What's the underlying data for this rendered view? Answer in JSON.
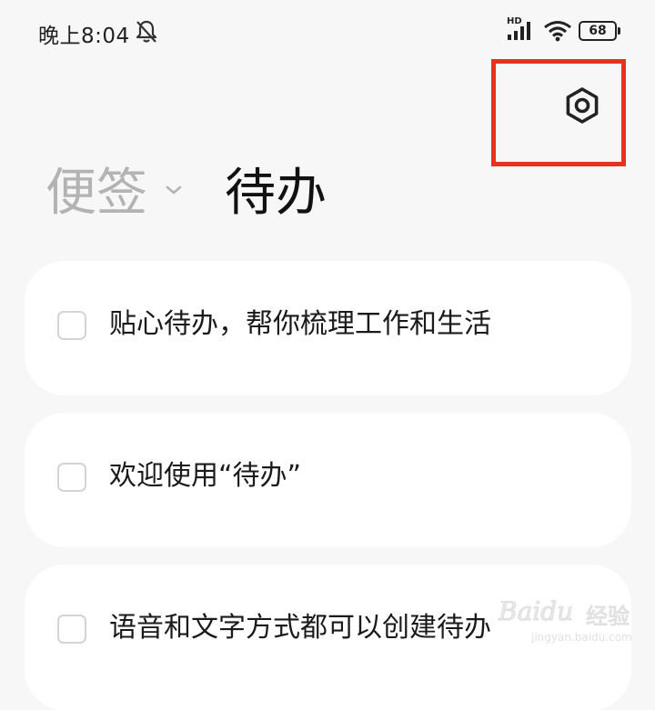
{
  "status_bar": {
    "time": "晚上8:04",
    "network_label": "HD",
    "battery_level": "68"
  },
  "header": {
    "notes_tab_label": "便签",
    "todo_tab_label": "待办"
  },
  "todos": [
    {
      "text": "贴心待办，帮你梳理工作和生活",
      "checked": false
    },
    {
      "text": "欢迎使用“待办”",
      "checked": false
    },
    {
      "text": "语音和文字方式都可以创建待办",
      "checked": false
    }
  ],
  "watermark": {
    "brand": "Baidu",
    "brand_cn": "经验",
    "url": "jingyan.baidu.com"
  },
  "colors": {
    "background": "#f7f7f7",
    "card": "#ffffff",
    "highlight_box": "#e8321e",
    "inactive_tab": "#b3b3b3"
  }
}
